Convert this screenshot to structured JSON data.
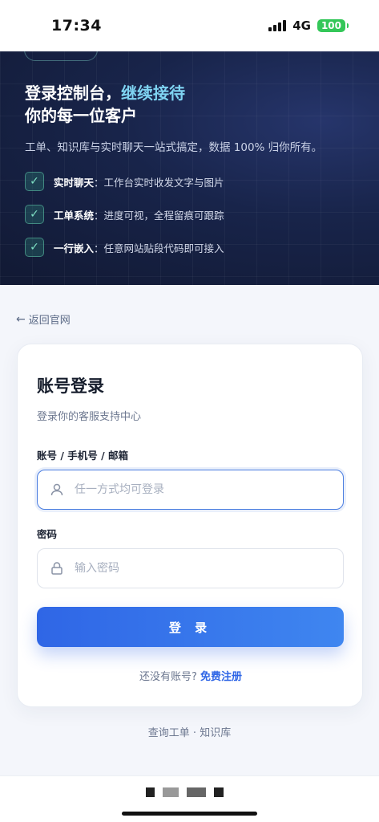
{
  "status_bar": {
    "time": "17:34",
    "network": "4G",
    "battery": "100"
  },
  "hero": {
    "title_line1_prefix": "登录控制台，",
    "title_line1_accent": "继续接待",
    "title_line2": "你的每一位客户",
    "description": "工单、知识库与实时聊天一站式搞定，数据 100% 归你所有。",
    "features": [
      {
        "title": "实时聊天",
        "text": "：工作台实时收发文字与图片"
      },
      {
        "title": "工单系统",
        "text": "：进度可视，全程留痕可跟踪"
      },
      {
        "title": "一行嵌入",
        "text": "：任意网站贴段代码即可接入"
      }
    ],
    "accent_color": "#7fd4f2"
  },
  "back_link": {
    "label": "返回官网"
  },
  "login_card": {
    "title": "账号登录",
    "subtitle": "登录你的客服支持中心",
    "account_label": "账号 / 手机号 / 邮箱",
    "account_placeholder": "任一方式均可登录",
    "password_label": "密码",
    "password_placeholder": "输入密码",
    "submit_label": "登 录",
    "no_account_text": "还没有账号?",
    "register_link": "免费注册",
    "primary_color": "#2f66e6"
  },
  "footer": {
    "links_text": "查询工单 · 知识库"
  }
}
